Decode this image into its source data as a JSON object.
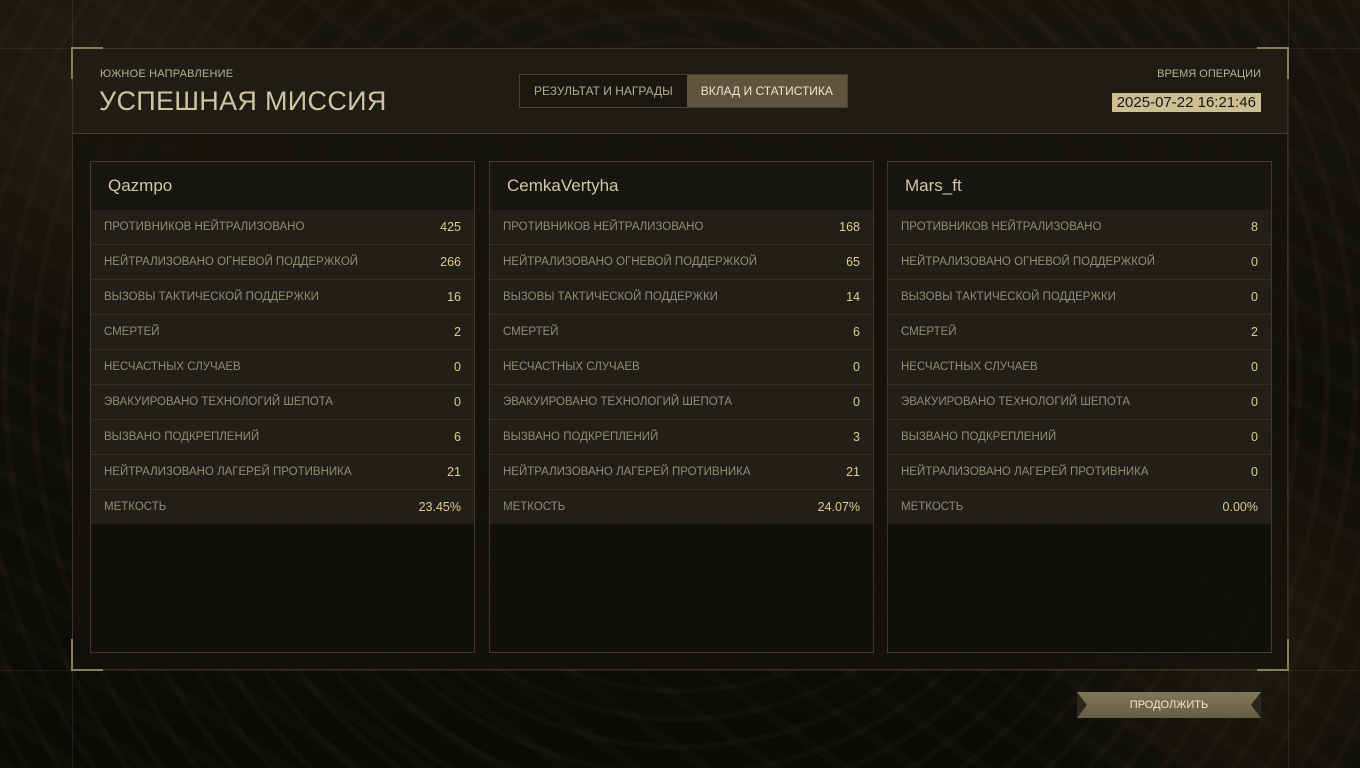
{
  "header": {
    "region": "ЮЖНОЕ НАПРАВЛЕНИЕ",
    "title": "УСПЕШНАЯ МИССИЯ",
    "tabs": [
      {
        "label": "РЕЗУЛЬТАТ И НАГРАДЫ",
        "active": false
      },
      {
        "label": "ВКЛАД И СТАТИСТИКА",
        "active": true
      }
    ],
    "op_time_label": "ВРЕМЯ ОПЕРАЦИИ",
    "op_time_value": "2025-07-22 16:21:46"
  },
  "stat_labels": [
    "ПРОТИВНИКОВ НЕЙТРАЛИЗОВАНО",
    "НЕЙТРАЛИЗОВАНО ОГНЕВОЙ ПОДДЕРЖКОЙ",
    "ВЫЗОВЫ ТАКТИЧЕСКОЙ ПОДДЕРЖКИ",
    "СМЕРТЕЙ",
    "НЕСЧАСТНЫХ СЛУЧАЕВ",
    "ЭВАКУИРОВАНО ТЕХНОЛОГИЙ ШЕПОТА",
    "ВЫЗВАНО ПОДКРЕПЛЕНИЙ",
    "НЕЙТРАЛИЗОВАНО ЛАГЕРЕЙ ПРОТИВНИКА",
    "МЕТКОСТЬ"
  ],
  "players": [
    {
      "name": "Qazmpo",
      "values": [
        "425",
        "266",
        "16",
        "2",
        "0",
        "0",
        "6",
        "21",
        "23.45%"
      ]
    },
    {
      "name": "CemkaVertyha",
      "values": [
        "168",
        "65",
        "14",
        "6",
        "0",
        "0",
        "3",
        "21",
        "24.07%"
      ]
    },
    {
      "name": "Mars_ft",
      "values": [
        "8",
        "0",
        "0",
        "2",
        "0",
        "0",
        "0",
        "0",
        "0.00%"
      ]
    }
  ],
  "footer": {
    "continue_label": "ПРОДОЛЖИТЬ"
  },
  "colors": {
    "accent_gold": "#cbbf93",
    "value_text": "#e2c98d",
    "active_tab": "#5e553c"
  }
}
